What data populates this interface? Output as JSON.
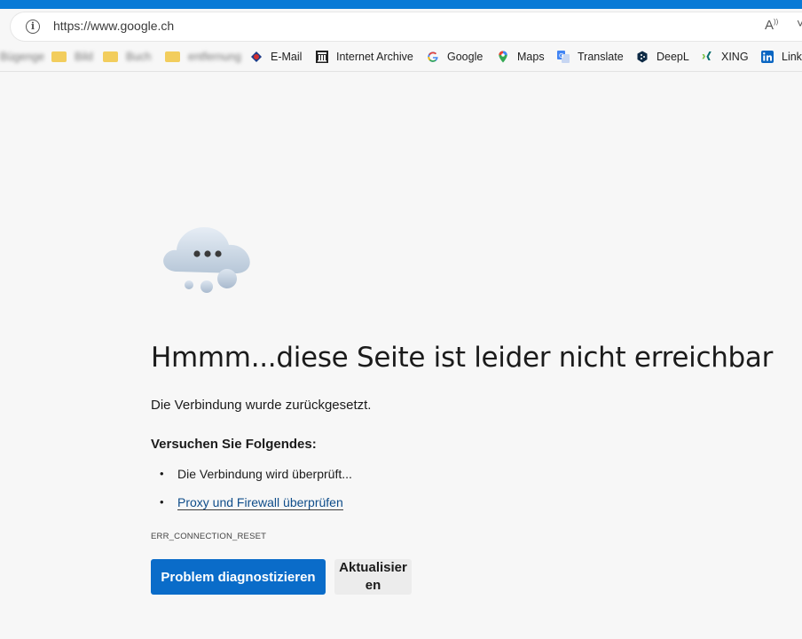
{
  "address_bar": {
    "url": "https://www.google.ch",
    "info_icon": "info-icon",
    "read_aloud_icon": "read-aloud-icon",
    "favorites_icon": "favorites-icon"
  },
  "bookmarks": [
    {
      "label": "Bügenge",
      "icon": "blurred",
      "blurred": true
    },
    {
      "label": "Bild",
      "icon": "folder-icon",
      "blurred": true
    },
    {
      "label": "Buch",
      "icon": "folder-icon",
      "blurred": true
    },
    {
      "label": "entfernung",
      "icon": "folder-icon",
      "blurred": true
    },
    {
      "label": "E-Mail",
      "icon": "email-icon",
      "color": "#d32f2f"
    },
    {
      "label": "Internet Archive",
      "icon": "archive-icon"
    },
    {
      "label": "Google",
      "icon": "google-icon"
    },
    {
      "label": "Maps",
      "icon": "maps-icon"
    },
    {
      "label": "Translate",
      "icon": "translate-icon"
    },
    {
      "label": "DeepL",
      "icon": "deepl-icon"
    },
    {
      "label": "XING",
      "icon": "xing-icon"
    },
    {
      "label": "Link",
      "icon": "linkedin-icon"
    }
  ],
  "error_page": {
    "icon": "cloud-icon",
    "title": "Hmmm...diese Seite ist leider nicht erreichbar",
    "subtitle": "Die Verbindung wurde zurückgesetzt.",
    "try_title": "Versuchen Sie Folgendes:",
    "tips": [
      {
        "text": "Die Verbindung wird überprüft...",
        "is_link": false
      },
      {
        "text": "Proxy und Firewall überprüfen",
        "is_link": true
      }
    ],
    "error_code": "ERR_CONNECTION_RESET",
    "primary_button": "Problem diagnostizieren",
    "secondary_button": "Aktualisieren"
  },
  "colors": {
    "accent": "#0a6cc9",
    "topbar": "#0a7ad6",
    "background": "#f7f7f7"
  }
}
